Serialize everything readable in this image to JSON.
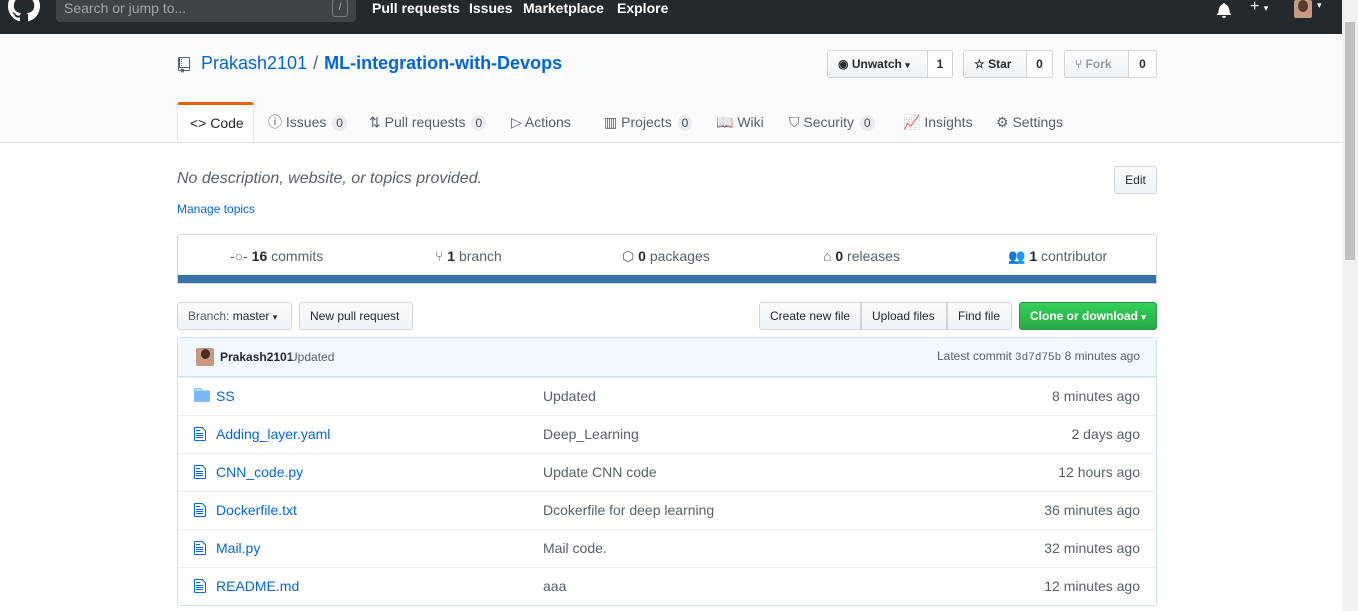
{
  "topbar": {
    "search_placeholder": "Search or jump to...",
    "search_shortcut": "/",
    "nav": [
      "Pull requests",
      "Issues",
      "Marketplace",
      "Explore"
    ]
  },
  "repo": {
    "owner": "Prakash2101",
    "separator": "/",
    "name": "ML-integration-with-Devops"
  },
  "actions": {
    "watch_label": "Unwatch",
    "watch_count": "1",
    "star_label": "Star",
    "star_count": "0",
    "fork_label": "Fork",
    "fork_count": "0"
  },
  "tabs": [
    {
      "label": "Code",
      "count": null
    },
    {
      "label": "Issues",
      "count": "0"
    },
    {
      "label": "Pull requests",
      "count": "0"
    },
    {
      "label": "Actions",
      "count": null
    },
    {
      "label": "Projects",
      "count": "0"
    },
    {
      "label": "Wiki",
      "count": null
    },
    {
      "label": "Security",
      "count": "0"
    },
    {
      "label": "Insights",
      "count": null
    },
    {
      "label": "Settings",
      "count": null
    }
  ],
  "about": {
    "description": "No description, website, or topics provided.",
    "manage_topics": "Manage topics",
    "edit_label": "Edit"
  },
  "summary": {
    "commits_num": "16",
    "commits_label": "commits",
    "branch_num": "1",
    "branch_label": "branch",
    "packages_num": "0",
    "packages_label": "packages",
    "releases_num": "0",
    "releases_label": "releases",
    "contributor_num": "1",
    "contributor_label": "contributor",
    "language_color": "#3572a5"
  },
  "toolbar": {
    "branch_prefix": "Branch:",
    "branch_name": "master",
    "new_pr": "New pull request",
    "create_file": "Create new file",
    "upload_files": "Upload files",
    "find_file": "Find file",
    "clone": "Clone or download"
  },
  "latest_commit": {
    "author": "Prakash2101",
    "message": "Updated",
    "prefix": "Latest commit",
    "sha": "3d7d75b",
    "age": "8 minutes ago"
  },
  "files": [
    {
      "type": "folder-icon",
      "name": "SS",
      "message": "Updated",
      "age": "8 minutes ago"
    },
    {
      "type": "file-icon",
      "name": "Adding_layer.yaml",
      "message": "Deep_Learning",
      "age": "2 days ago"
    },
    {
      "type": "file-icon",
      "name": "CNN_code.py",
      "message": "Update CNN code",
      "age": "12 hours ago"
    },
    {
      "type": "file-icon",
      "name": "Dockerfile.txt",
      "message": "Dcokerfile for deep learning",
      "age": "36 minutes ago"
    },
    {
      "type": "file-icon",
      "name": "Mail.py",
      "message": "Mail code.",
      "age": "32 minutes ago"
    },
    {
      "type": "file-icon",
      "name": "README.md",
      "message": "aaa",
      "age": "12 minutes ago"
    }
  ]
}
